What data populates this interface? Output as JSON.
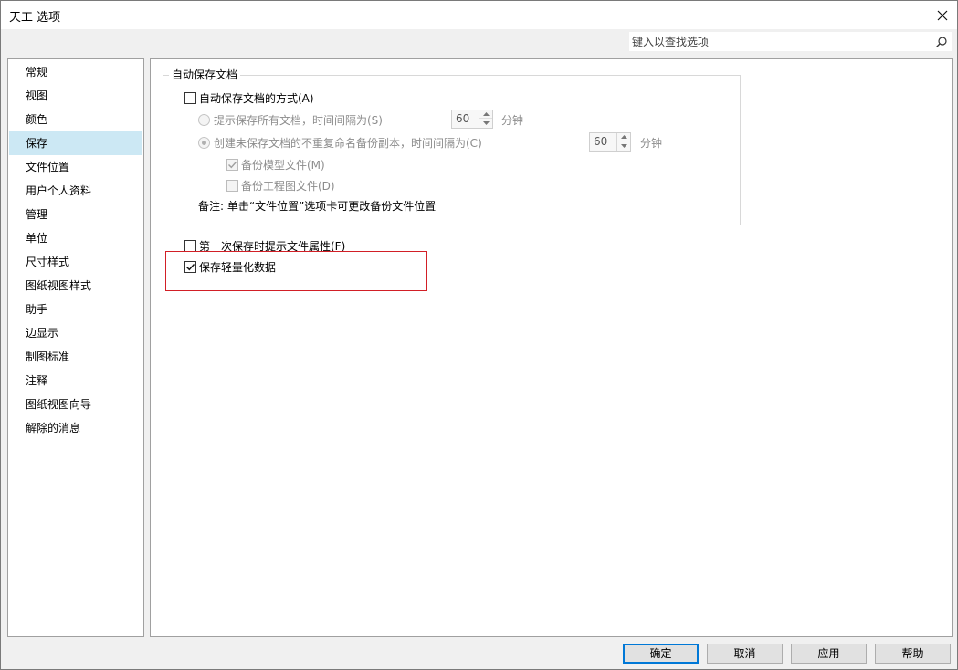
{
  "window": {
    "title": "天工 选项"
  },
  "search": {
    "placeholder": "键入以查找选项"
  },
  "nav": {
    "items": [
      {
        "label": "常规"
      },
      {
        "label": "视图"
      },
      {
        "label": "颜色"
      },
      {
        "label": "保存",
        "selected": true
      },
      {
        "label": "文件位置"
      },
      {
        "label": "用户个人资料"
      },
      {
        "label": "管理"
      },
      {
        "label": "单位"
      },
      {
        "label": "尺寸样式"
      },
      {
        "label": "图纸视图样式"
      },
      {
        "label": "助手"
      },
      {
        "label": "边显示"
      },
      {
        "label": "制图标准"
      },
      {
        "label": "注释"
      },
      {
        "label": "图纸视图向导"
      },
      {
        "label": "解除的消息"
      }
    ]
  },
  "autosave": {
    "group_label": "自动保存文档",
    "enable_label": "自动保存文档的方式(A)",
    "enable_checked": false,
    "option_prompt_label": "提示保存所有文档，时间间隔为(S)",
    "option_prompt_value": "60",
    "option_backup_label": "创建未保存文档的不重复命名备份副本，时间间隔为(C)",
    "option_backup_value": "60",
    "unit": "分钟",
    "backup_model_label": "备份模型文件(M)",
    "backup_model_checked": true,
    "backup_drawing_label": "备份工程图文件(D)",
    "backup_drawing_checked": false,
    "note": "备注: 单击“文件位置”选项卡可更改备份文件位置"
  },
  "options": {
    "prompt_props_label": "第一次保存时提示文件属性(F)",
    "prompt_props_checked": false,
    "lightweight_label": "保存轻量化数据",
    "lightweight_checked": true
  },
  "buttons": {
    "ok": "确定",
    "cancel": "取消",
    "apply": "应用",
    "help": "帮助"
  },
  "colors": {
    "selection": "#cce8f4",
    "highlight_border": "#d21f26",
    "default_button_border": "#0078d7"
  }
}
